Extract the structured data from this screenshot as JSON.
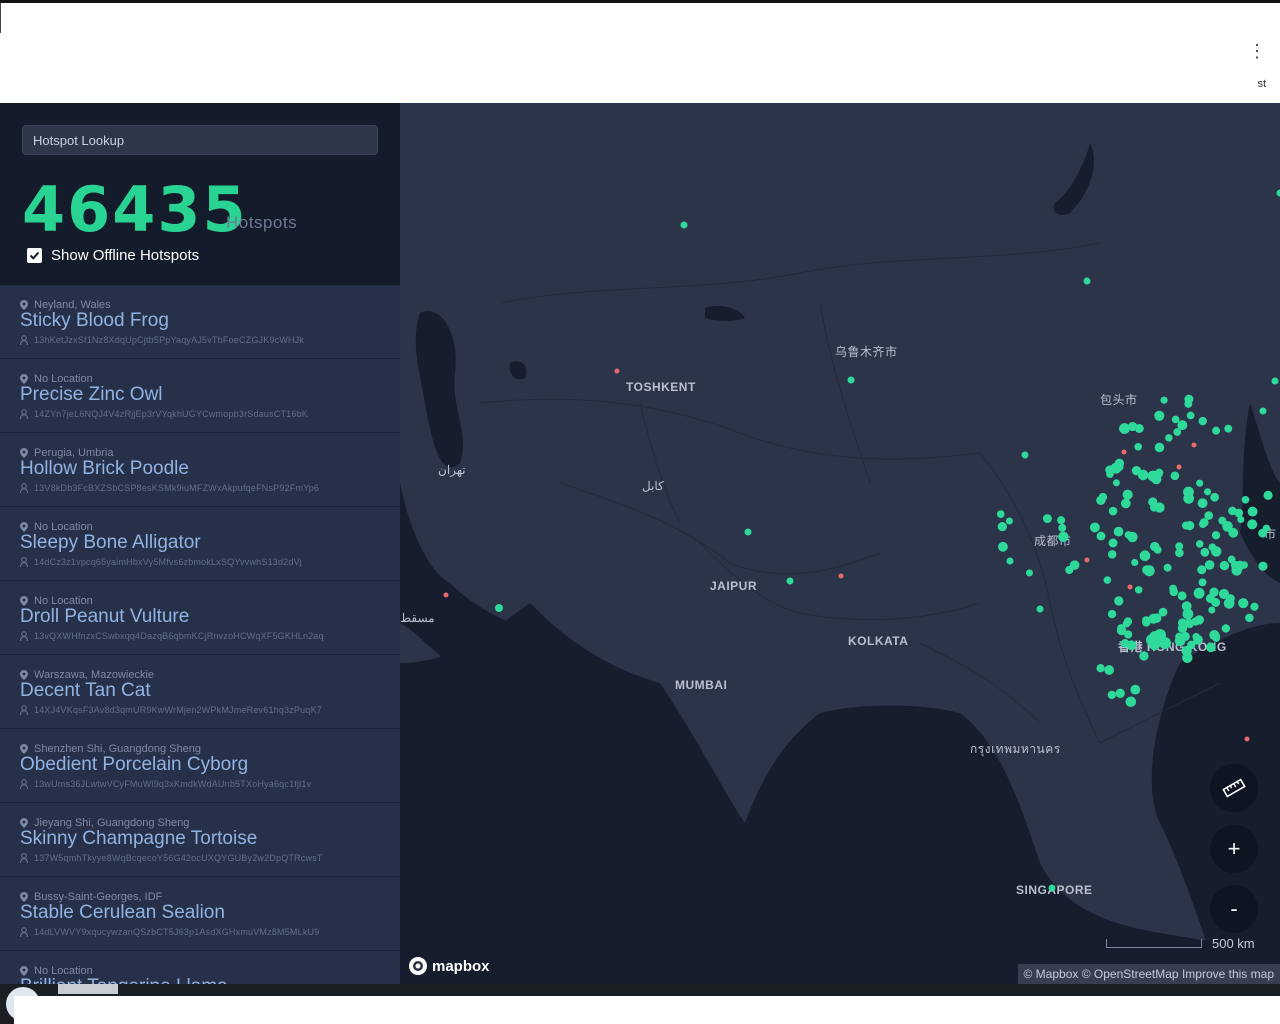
{
  "browser": {
    "menu_icon": "kebab-menu-icon",
    "corner_text": "st"
  },
  "sidebar": {
    "lookup_placeholder": "Hotspot Lookup",
    "count": "46435",
    "count_label": "Hotspots",
    "show_offline_label": "Show Offline Hotspots",
    "show_offline_checked": true,
    "items": [
      {
        "location": "Neyland, Wales",
        "name": "Sticky Blood Frog",
        "address": "13hKetJzxSf1Nz8XdqUpCjtb5PpYaqyAJ5vTbFoeCZGJK9cWHJk"
      },
      {
        "location": "No Location",
        "name": "Precise Zinc Owl",
        "address": "14ZYn7jeL6NQJ4V4zRjjEp3rVYqkhUGYCwmopb3rSdausCT16bK"
      },
      {
        "location": "Perugia, Umbria",
        "name": "Hollow Brick Poodle",
        "address": "13V8kDb3FcBXZSbCSP8esKSMk9iuMFZWxAkpufqeFNsP92FmYp6"
      },
      {
        "location": "No Location",
        "name": "Sleepy Bone Alligator",
        "address": "14dCz3z1vpcq65yaimHbxVy5Mfvs6zbmokLxSQYvvwhS13d2dVj"
      },
      {
        "location": "No Location",
        "name": "Droll Peanut Vulture",
        "address": "13vQXWHfnzxCSwbxqq4DazqB6qbmKCjRnvzoHCWqXF5GKHLn2aq"
      },
      {
        "location": "Warszawa, Mazowieckie",
        "name": "Decent Tan Cat",
        "address": "14XJ4VKqsF3Av8d3qmUR9KwWrMjen2WPkMJmeRev61hq3zPuqK7"
      },
      {
        "location": "Shenzhen Shi, Guangdong Sheng",
        "name": "Obedient Porcelain Cyborg",
        "address": "13wUms36JLwtwVCyFMuWi9q3xKmdkWdAUnb5TXoHya6qc1fjl1v"
      },
      {
        "location": "Jieyang Shi, Guangdong Sheng",
        "name": "Skinny Champagne Tortoise",
        "address": "137W5qmhTkyye8WqBcqecoY56G42ocUXQYGUBy2w2DpQTRcwsT"
      },
      {
        "location": "Bussy-Saint-Georges, IDF",
        "name": "Stable Cerulean Sealion",
        "address": "14dLVWVY9xqucywzanQSzbCT5J63p1AsdXGHxmuVMz8M5MLkU9"
      },
      {
        "location": "No Location",
        "name": "Brilliant Tangerine Llama",
        "address": ""
      }
    ]
  },
  "map": {
    "labels": {
      "toshkent": "TOSHKENT",
      "urumqi": "乌鲁木齐市",
      "baotou": "包头市",
      "tehran": "تهران",
      "kabul": "کابل",
      "chengdu": "成都市",
      "jaipur": "JAIPUR",
      "kolkata": "KOLKATA",
      "mumbai": "MUMBAI",
      "hongkong": "香港 HONG KONG",
      "bangkok": "กรุงเทพมหานคร",
      "singapore": "SINGAPORE",
      "gulf": "مسقط",
      "edge_city": "市"
    },
    "controls": {
      "ruler_icon": "ruler-icon",
      "zoom_in": "+",
      "zoom_out": "-"
    },
    "scale_text": "500 km",
    "logo_text": "mapbox",
    "attribution": {
      "mapbox": "© Mapbox",
      "osm": "© OpenStreetMap",
      "improve": "Improve this map"
    },
    "online_color": "#2ed99a",
    "offline_color": "#e76b6b"
  }
}
